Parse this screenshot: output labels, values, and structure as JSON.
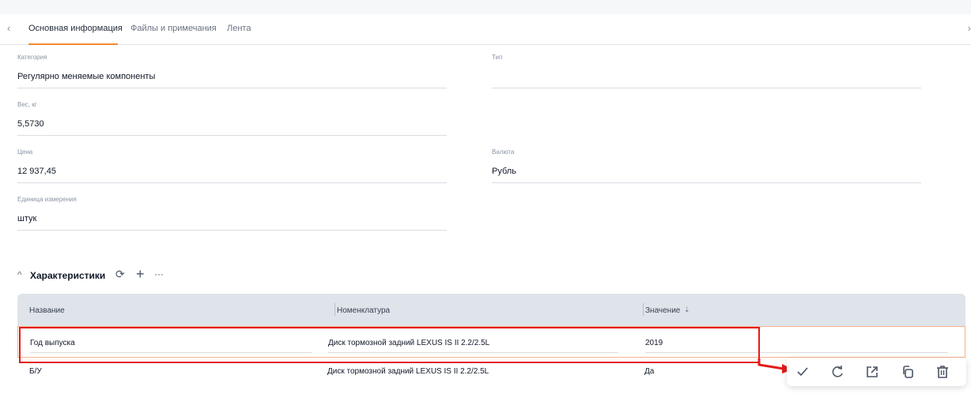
{
  "tabs": {
    "items": [
      {
        "label": "Основная информация",
        "active": true
      },
      {
        "label": "Файлы и примечания",
        "active": false
      },
      {
        "label": "Лента",
        "active": false
      }
    ]
  },
  "fields": {
    "category": {
      "label": "Категория",
      "value": "Регулярно меняемые компоненты"
    },
    "type": {
      "label": "Тип",
      "value": ""
    },
    "weight": {
      "label": "Вес, кг",
      "value": "5,5730"
    },
    "price": {
      "label": "Цена",
      "value": "12 937,45"
    },
    "currency": {
      "label": "Валюта",
      "value": "Рубль"
    },
    "unit": {
      "label": "Единица измерения",
      "value": "штук"
    }
  },
  "characteristics": {
    "title": "Характеристики",
    "columns": [
      "Название",
      "Номенклатура",
      "Значение"
    ],
    "rows": [
      {
        "name": "Год выпуска",
        "nomenclature": "Диск тормозной задний LEXUS IS II 2.2/2.5L",
        "value": "2019"
      },
      {
        "name": "Б/У",
        "nomenclature": "Диск тормозной задний LEXUS IS II 2.2/2.5L",
        "value": "Да"
      }
    ]
  },
  "icons": {
    "back": "chevron-left-icon",
    "close": "close-icon",
    "collapse": "chevron-up-icon",
    "refresh": "refresh-icon",
    "add": "plus-icon",
    "more": "more-icon",
    "sort": "sort-icon",
    "actions": [
      "check-icon",
      "reload-icon",
      "open-external-icon",
      "copy-icon",
      "delete-icon"
    ]
  },
  "colors": {
    "accent": "#f28a2e",
    "highlight": "#e31b1b",
    "header_bg": "#dfe3ea"
  }
}
